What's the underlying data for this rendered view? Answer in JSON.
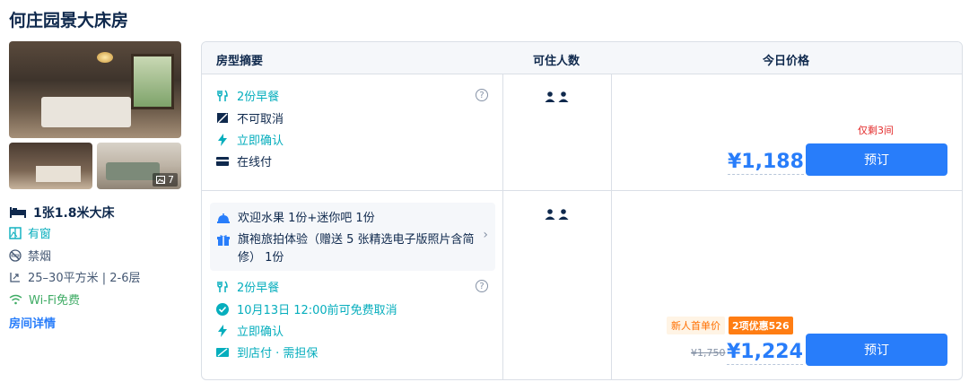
{
  "room": {
    "title": "何庄园景大床房",
    "photo_count": "7",
    "bed": "1张1.8米大床",
    "window": "有窗",
    "smoking": "禁烟",
    "area_floor": "25–30平方米 | 2-6层",
    "wifi": "Wi-Fi免费",
    "detail_link": "房间详情"
  },
  "table": {
    "headers": {
      "summary": "房型摘要",
      "guests": "可住人数",
      "price": "今日价格"
    },
    "offers": [
      {
        "breakfast": "2份早餐",
        "cancel": "不可取消",
        "confirm": "立即确认",
        "payment": "在线付",
        "stock": "仅剩3间",
        "price": "¥1,188",
        "book_label": "预订",
        "help": "?"
      },
      {
        "gift_1": "欢迎水果 1份+迷你吧 1份",
        "gift_2": "旗袍旅拍体验（赠送 5 张精选电子版照片含简修） 1份",
        "breakfast": "2份早餐",
        "cancel": "10月13日 12:00前可免费取消",
        "confirm": "立即确认",
        "payment": "到店付 · 需担保",
        "new_user_tag": "新人首单价",
        "discount_tag": "2项优惠526",
        "original_price": "¥1,750",
        "price": "¥1,224",
        "book_label": "预订",
        "help": "?"
      }
    ]
  },
  "colors": {
    "accent": "#287dfa",
    "green": "#06aebd",
    "red": "#e32b2b",
    "orange": "#ff7d13"
  }
}
